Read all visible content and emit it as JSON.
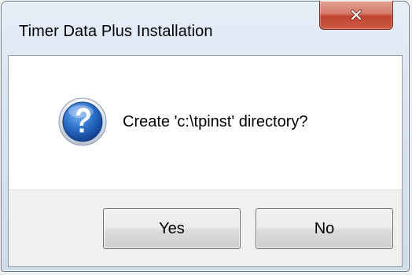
{
  "window": {
    "title": "Timer Data Plus Installation",
    "close_icon": "close-icon"
  },
  "message": {
    "icon": "question-icon",
    "text": "Create 'c:\\tpinst' directory?"
  },
  "buttons": {
    "yes_label": "Yes",
    "no_label": "No"
  },
  "colors": {
    "close_button": "#c1442f",
    "question_icon": "#1f5fb8"
  }
}
